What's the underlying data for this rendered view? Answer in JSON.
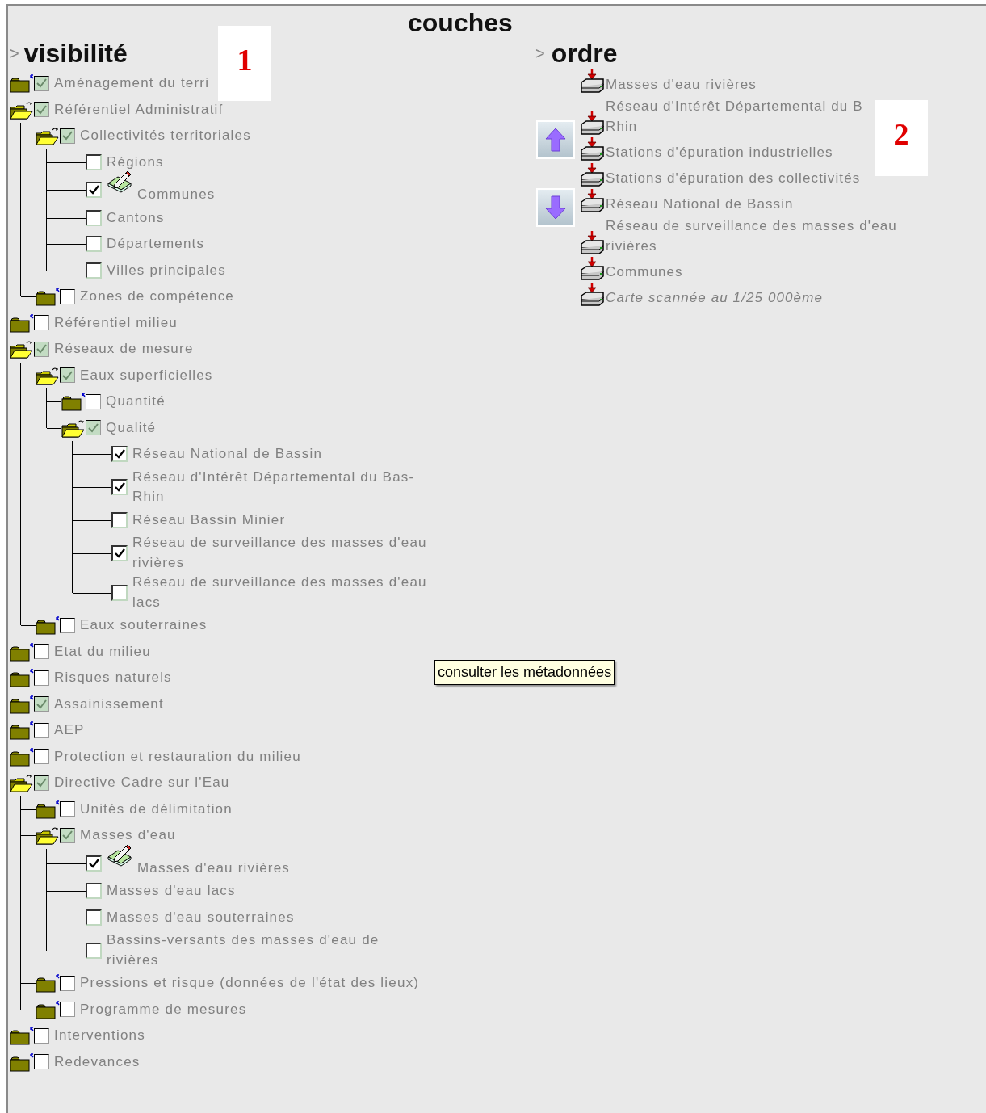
{
  "title": "couches",
  "visibility": {
    "heading_marker": ">",
    "heading": "visibilité",
    "tree": [
      {
        "kind": "group",
        "label": "Aménagement du terri",
        "expanded": false,
        "checked": true
      },
      {
        "kind": "group",
        "label": "Référentiel Administratif",
        "expanded": true,
        "checked": true,
        "children": [
          {
            "kind": "group",
            "label": "Collectivités territoriales",
            "expanded": true,
            "checked": true,
            "children": [
              {
                "kind": "layer",
                "label": "Régions",
                "checked": false
              },
              {
                "kind": "editable_layer",
                "label": "Communes",
                "checked": true
              },
              {
                "kind": "layer",
                "label": "Cantons",
                "checked": false
              },
              {
                "kind": "layer",
                "label": "Départements",
                "checked": false
              },
              {
                "kind": "layer",
                "label": "Villes principales",
                "checked": false
              }
            ]
          },
          {
            "kind": "group",
            "label": "Zones de compétence",
            "expanded": false,
            "checked": false
          }
        ]
      },
      {
        "kind": "group",
        "label": "Référentiel milieu",
        "expanded": false,
        "checked": false
      },
      {
        "kind": "group",
        "label": "Réseaux de mesure",
        "expanded": true,
        "checked": true,
        "children": [
          {
            "kind": "group",
            "label": "Eaux superficielles",
            "expanded": true,
            "checked": true,
            "children": [
              {
                "kind": "group",
                "label": "Quantité",
                "expanded": false,
                "checked": false
              },
              {
                "kind": "group",
                "label": "Qualité",
                "expanded": true,
                "checked": true,
                "children": [
                  {
                    "kind": "layer",
                    "label": "Réseau National de Bassin",
                    "checked": true
                  },
                  {
                    "kind": "layer",
                    "label": "Réseau d'Intérêt Départemental du Bas-Rhin",
                    "checked": true
                  },
                  {
                    "kind": "layer",
                    "label": "Réseau Bassin Minier",
                    "checked": false
                  },
                  {
                    "kind": "layer",
                    "label": "Réseau de surveillance des masses d'eau rivières",
                    "checked": true
                  },
                  {
                    "kind": "layer",
                    "label": "Réseau de surveillance des masses d'eau lacs",
                    "checked": false
                  }
                ]
              }
            ]
          },
          {
            "kind": "group",
            "label": "Eaux souterraines",
            "expanded": false,
            "checked": false
          }
        ]
      },
      {
        "kind": "group",
        "label": "Etat du milieu",
        "expanded": false,
        "checked": false
      },
      {
        "kind": "group",
        "label": "Risques naturels",
        "expanded": false,
        "checked": false
      },
      {
        "kind": "group",
        "label": "Assainissement",
        "expanded": false,
        "checked": true
      },
      {
        "kind": "group",
        "label": "AEP",
        "expanded": false,
        "checked": false
      },
      {
        "kind": "group",
        "label": "Protection et restauration du milieu",
        "expanded": false,
        "checked": false
      },
      {
        "kind": "group",
        "label": "Directive Cadre sur l'Eau",
        "expanded": true,
        "checked": true,
        "children": [
          {
            "kind": "group",
            "label": "Unités de délimitation",
            "expanded": false,
            "checked": false
          },
          {
            "kind": "group",
            "label": "Masses d'eau",
            "expanded": true,
            "checked": true,
            "children": [
              {
                "kind": "editable_layer",
                "label": "Masses d'eau rivières",
                "checked": true
              },
              {
                "kind": "layer",
                "label": "Masses d'eau lacs",
                "checked": false
              },
              {
                "kind": "layer",
                "label": "Masses d'eau souterraines",
                "checked": false
              },
              {
                "kind": "layer",
                "label": "Bassins-versants des masses d'eau de rivières",
                "checked": false
              }
            ]
          },
          {
            "kind": "group",
            "label": "Pressions et risque (données de l'état des lieux)",
            "expanded": false,
            "checked": false
          },
          {
            "kind": "group",
            "label": "Programme de mesures",
            "expanded": false,
            "checked": false
          }
        ]
      },
      {
        "kind": "group",
        "label": "Interventions",
        "expanded": false,
        "checked": false
      },
      {
        "kind": "group",
        "label": "Redevances",
        "expanded": false,
        "checked": false
      }
    ]
  },
  "order": {
    "heading_marker": ">",
    "heading": "ordre",
    "items": [
      {
        "lines": [
          "Masses d'eau rivières"
        ],
        "italic": false
      },
      {
        "lines": [
          "Réseau d'Intérêt Départemental du B",
          "Rhin"
        ],
        "italic": false
      },
      {
        "lines": [
          "Stations d'épuration industrielles"
        ],
        "italic": false
      },
      {
        "lines": [
          "Stations d'épuration des collectivités"
        ],
        "italic": false
      },
      {
        "lines": [
          "Réseau National de Bassin"
        ],
        "italic": false
      },
      {
        "lines": [
          "Réseau de surveillance des masses d'eau",
          "rivières"
        ],
        "italic": false
      },
      {
        "lines": [
          "Communes"
        ],
        "italic": false
      },
      {
        "lines": [
          "Carte scannée au 1/25 000ème"
        ],
        "italic": true
      }
    ]
  },
  "callouts": [
    "1",
    "2"
  ],
  "tooltip": "consulter les métadonnées"
}
